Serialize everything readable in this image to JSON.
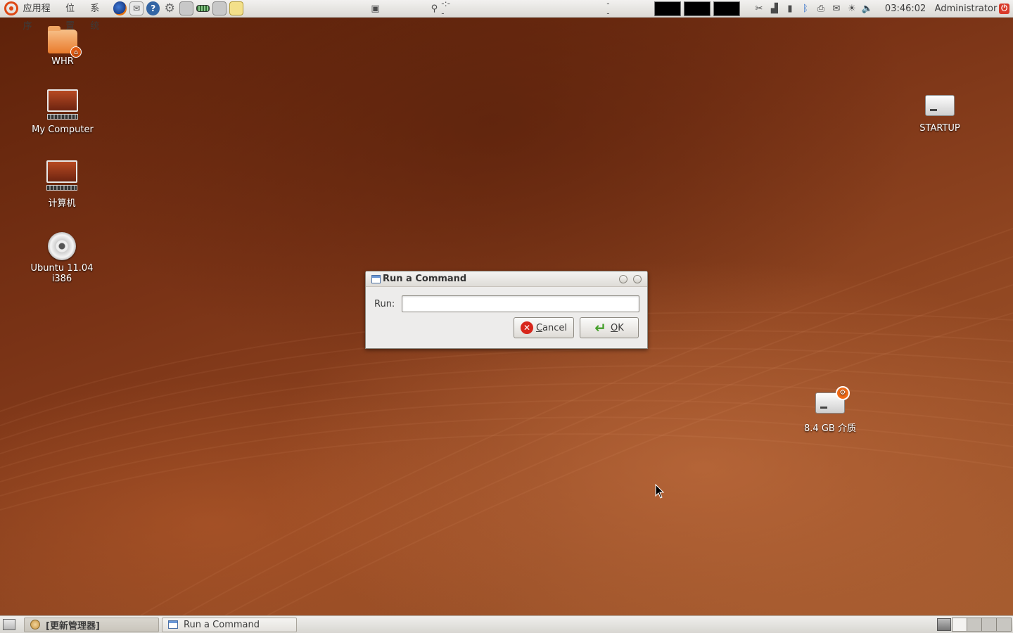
{
  "top_panel": {
    "menus": [
      "应用程序",
      "位置",
      "系统"
    ],
    "launchers": [
      "firefox-icon",
      "mail-icon",
      "help-icon",
      "settings-icon",
      "network-icon",
      "memory-icon",
      "usb-icon",
      "notes-icon"
    ],
    "indicator_text": "-:--",
    "mid_text": "--",
    "clock": "03:46:02",
    "user": "Administrator"
  },
  "desktop": {
    "icons": [
      {
        "label": "WHR",
        "icon": "home-folder-icon"
      },
      {
        "label": "My Computer",
        "icon": "computer-icon"
      },
      {
        "label": "计算机",
        "icon": "computer-icon"
      },
      {
        "label": "Ubuntu 11.04 i386",
        "icon": "cdrom-icon"
      },
      {
        "label": "STARTUP",
        "icon": "drive-icon"
      },
      {
        "label": "8.4 GB 介质",
        "icon": "drive-icon"
      }
    ]
  },
  "dialog": {
    "title": "Run a Command",
    "run_label": "Run:",
    "run_value": "",
    "cancel_label": "Cancel",
    "cancel_mnemonic": "C",
    "cancel_rest": "ancel",
    "ok_mnemonic": "O",
    "ok_rest": "K"
  },
  "bottom_panel": {
    "tasks": [
      {
        "label": "[更新管理器]",
        "active": true
      },
      {
        "label": "Run a Command",
        "active": false
      }
    ]
  },
  "colors": {
    "accent": "#dd4814",
    "panel": "#e6e4df",
    "wallpaper": "#7a3618"
  }
}
